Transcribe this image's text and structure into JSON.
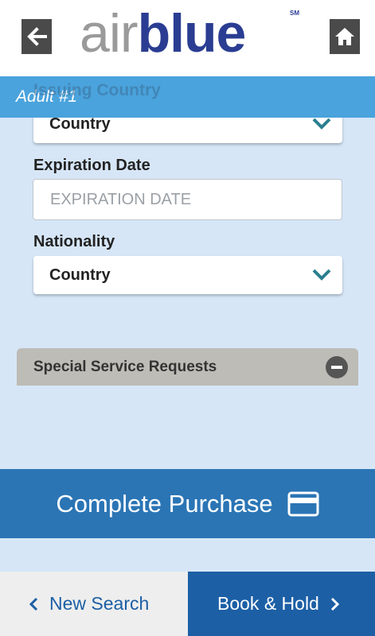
{
  "header": {
    "back_icon": "arrow-left-icon",
    "home_icon": "home-icon",
    "logo": {
      "air": "air",
      "blue": "blue",
      "sm": "SM"
    }
  },
  "passenger": {
    "title": "Adult #1",
    "issuing_country_label": "Issuing Country",
    "issuing_country_value": "Country",
    "expiration_label": "Expiration Date",
    "expiration_placeholder": "EXPIRATION DATE",
    "expiration_value": "",
    "nationality_label": "Nationality",
    "nationality_value": "Country"
  },
  "ssr": {
    "label": "Special Service Requests",
    "toggle_icon": "minus-circle-icon"
  },
  "actions": {
    "complete_purchase": "Complete Purchase",
    "card_icon": "credit-card-icon"
  },
  "footer": {
    "new_search": "New Search",
    "book_hold": "Book & Hold",
    "left_icon": "chevron-left-icon",
    "right_icon": "chevron-right-icon"
  },
  "colors": {
    "page_bg": "#d6e6f7",
    "section_bar": "#4aa3dc",
    "chevron": "#2a7f8f",
    "ssr_bar": "#bdbcb6",
    "purchase_bg": "#2b75b5",
    "footer_left_bg": "#eeeeee",
    "footer_right_bg": "#1c5fa5",
    "brand_blue": "#2a3d92",
    "brand_gray": "#9a9a9a"
  }
}
